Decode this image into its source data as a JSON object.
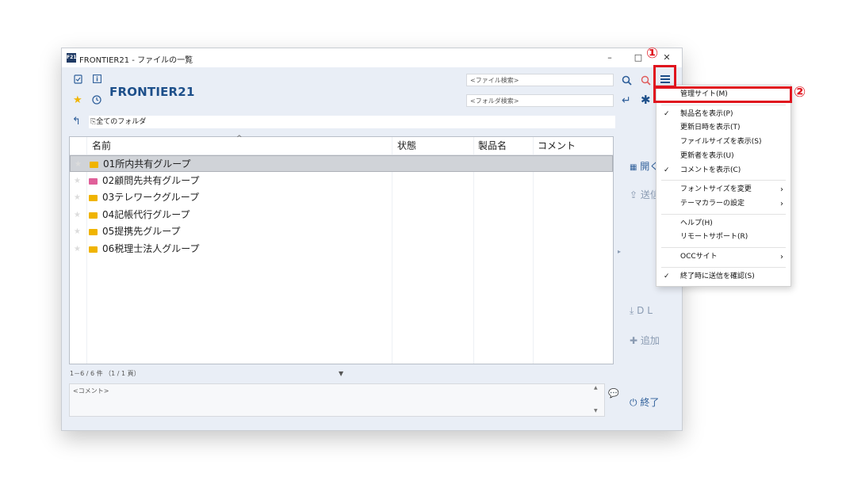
{
  "window": {
    "app_icon": "F21",
    "title": "FRONTIER21 - ファイルの一覧",
    "brand": "FRONTIER21",
    "minimize": "–",
    "maximize": "□",
    "close": "✕"
  },
  "search": {
    "file_placeholder": "<ファイル検索>",
    "folder_placeholder": "<フォルダ検索>"
  },
  "path": {
    "label": "全てのフォルダ"
  },
  "columns": [
    "名前",
    "状態",
    "製品名",
    "コメント"
  ],
  "sort_indicator": "^",
  "rows": [
    {
      "name": "01所内共有グループ",
      "folder_color": "#f0b400",
      "selected": true
    },
    {
      "name": "02顧問先共有グループ",
      "folder_color": "#e0609a",
      "selected": false
    },
    {
      "name": "03テレワークグループ",
      "folder_color": "#f0b400",
      "selected": false
    },
    {
      "name": "04記帳代行グループ",
      "folder_color": "#f0b400",
      "selected": false
    },
    {
      "name": "05提携先グループ",
      "folder_color": "#f0b400",
      "selected": false
    },
    {
      "name": "06税理士法人グループ",
      "folder_color": "#f0b400",
      "selected": false
    }
  ],
  "status": {
    "count": "1－6 / 6 件 （1 / 1 頁）",
    "dropdown": "▼"
  },
  "comment": {
    "placeholder": "<コメント>"
  },
  "side": {
    "open": "開く",
    "send": "送信",
    "dl": "D L",
    "add": "追加",
    "exit": "終了"
  },
  "menu": {
    "items": [
      {
        "label": "管理サイト(M)",
        "checked": false,
        "submenu": false
      },
      {
        "label": "製品名を表示(P)",
        "checked": true,
        "submenu": false
      },
      {
        "label": "更新日時を表示(T)",
        "checked": false,
        "submenu": false
      },
      {
        "label": "ファイルサイズを表示(S)",
        "checked": false,
        "submenu": false
      },
      {
        "label": "更新者を表示(U)",
        "checked": false,
        "submenu": false
      },
      {
        "label": "コメントを表示(C)",
        "checked": true,
        "submenu": false
      },
      {
        "label": "フォントサイズを変更",
        "checked": false,
        "submenu": true
      },
      {
        "label": "テーマカラーの設定",
        "checked": false,
        "submenu": true
      },
      {
        "label": "ヘルプ(H)",
        "checked": false,
        "submenu": false
      },
      {
        "label": "リモートサポート(R)",
        "checked": false,
        "submenu": false
      },
      {
        "label": "OCCサイト",
        "checked": false,
        "submenu": true
      },
      {
        "label": "終了時に送信を確認(S)",
        "checked": true,
        "submenu": false
      }
    ]
  },
  "callouts": {
    "one": "①",
    "two": "②"
  },
  "colors": {
    "accent": "#1d4f8a",
    "highlight": "#e0141e",
    "window_bg": "#e9eef6"
  }
}
